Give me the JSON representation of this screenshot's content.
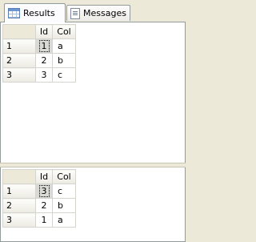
{
  "tabs": [
    {
      "label": "Results",
      "icon": "grid-icon",
      "active": true
    },
    {
      "label": "Messages",
      "icon": "messages-icon",
      "active": false
    }
  ],
  "grid1": {
    "headers": [
      "Id",
      "Col"
    ],
    "rows": [
      {
        "num": "1",
        "id": "1",
        "col": "a"
      },
      {
        "num": "2",
        "id": "2",
        "col": "b"
      },
      {
        "num": "3",
        "id": "3",
        "col": "c"
      }
    ]
  },
  "grid2": {
    "headers": [
      "Id",
      "Col"
    ],
    "rows": [
      {
        "num": "1",
        "id": "3",
        "col": "c"
      },
      {
        "num": "2",
        "id": "2",
        "col": "b"
      },
      {
        "num": "3",
        "id": "1",
        "col": "a"
      }
    ]
  }
}
